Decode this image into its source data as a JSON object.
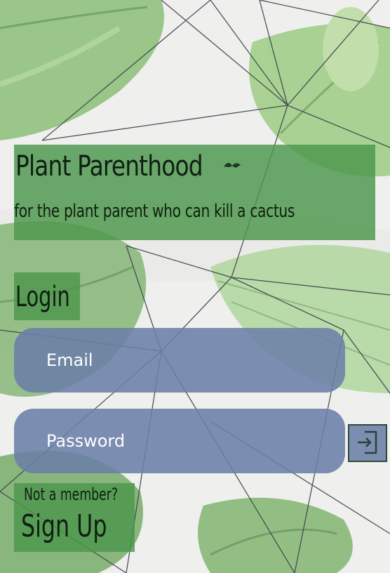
{
  "header": {
    "title": "Plant Parenthood",
    "tagline": "for the plant parent who can kill a cactus"
  },
  "login": {
    "heading": "Login",
    "email_placeholder": "Email",
    "password_placeholder": "Password",
    "submit_icon": "login-icon"
  },
  "signup": {
    "prompt": "Not a member?",
    "link": "Sign Up"
  },
  "colors": {
    "panel_green": "#4c964c",
    "field_blue": "#6b80a7",
    "text_dark": "#0f1f12",
    "field_text": "#ffffff"
  }
}
